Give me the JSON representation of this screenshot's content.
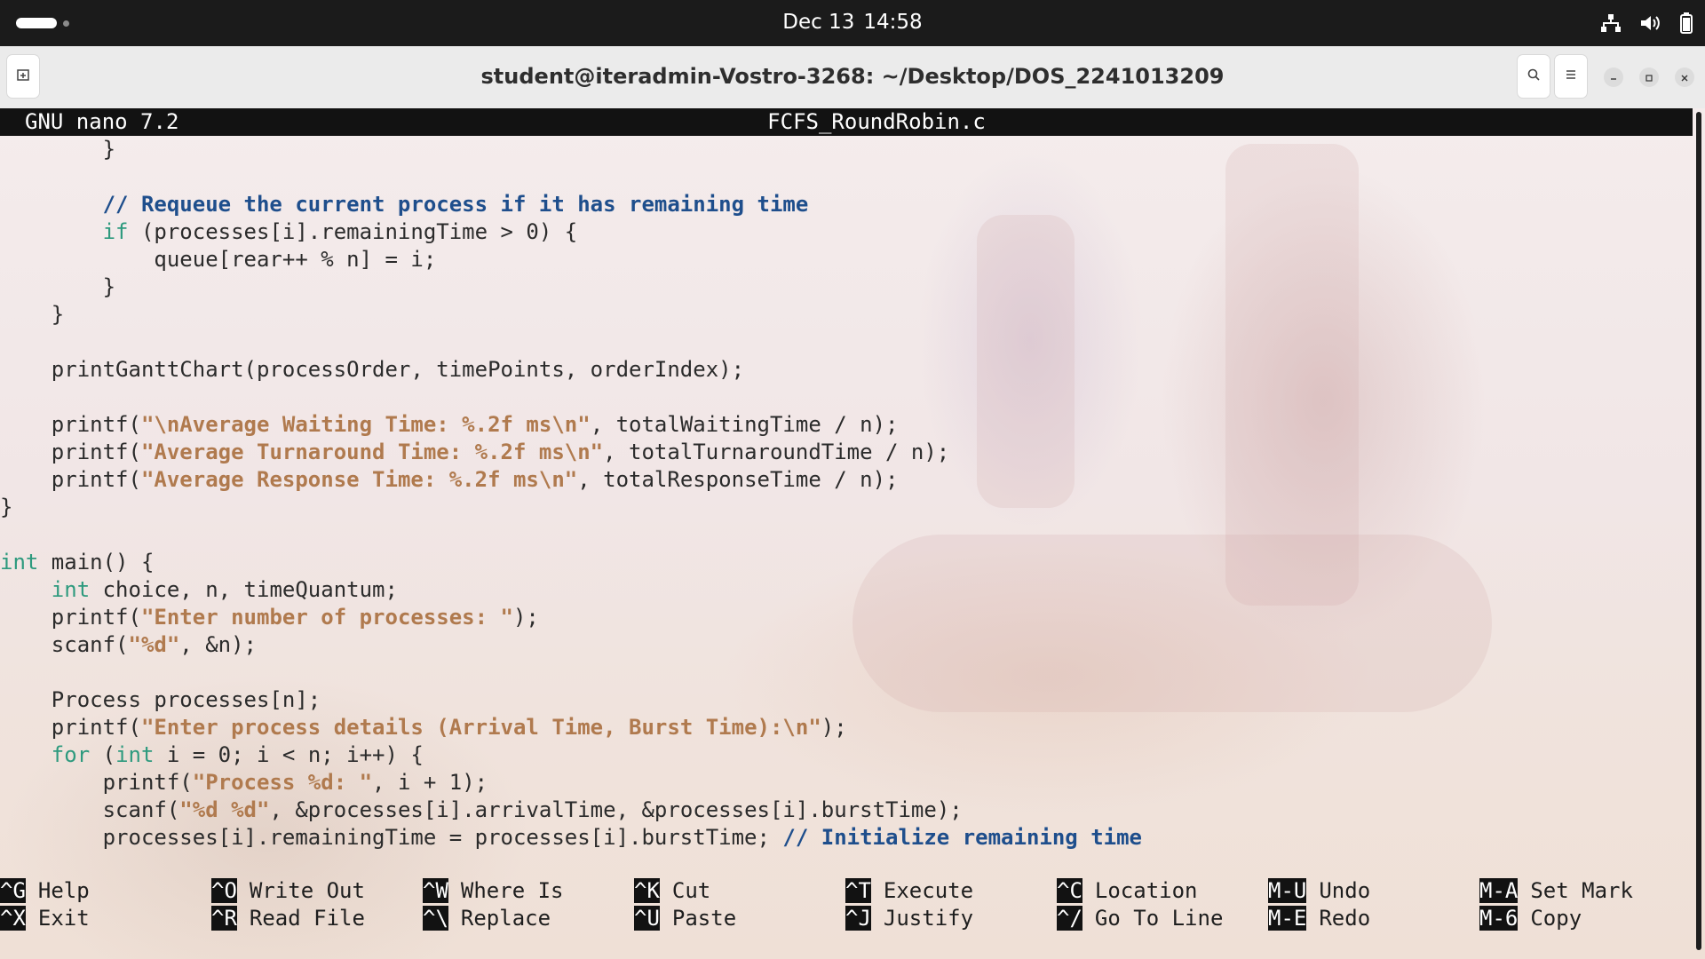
{
  "topbar": {
    "date": "Dec 13",
    "time": "14:58",
    "tray_icons": [
      "network-icon",
      "volume-icon",
      "battery-icon"
    ]
  },
  "window": {
    "title": "student@iteradmin-Vostro-3268: ~/Desktop/DOS_2241013209",
    "buttons": [
      "new-tab-icon",
      "search-icon",
      "menu-icon",
      "minimize-icon",
      "maximize-icon",
      "close-icon"
    ]
  },
  "nano": {
    "version": "GNU nano 7.2",
    "filename": "FCFS_RoundRobin.c"
  },
  "code": {
    "l1_a": "        }",
    "l3_comment": "        // Requeue the current process if it has remaining time",
    "l4_kw": "        if",
    "l4_rest": " (processes[i].remainingTime > 0) {",
    "l5": "            queue[rear++ % n] = i;",
    "l6": "        }",
    "l7": "    }",
    "l9": "    printGanttChart(processOrder, timePoints, orderIndex);",
    "l11_a": "    printf(",
    "l11_s": "\"\\nAverage Waiting Time: %.2f ms\\n\"",
    "l11_b": ", totalWaitingTime / n);",
    "l12_a": "    printf(",
    "l12_s": "\"Average Turnaround Time: %.2f ms\\n\"",
    "l12_b": ", totalTurnaroundTime / n);",
    "l13_a": "    printf(",
    "l13_s": "\"Average Response Time: %.2f ms\\n\"",
    "l13_b": ", totalResponseTime / n);",
    "l14": "}",
    "l16_kw": "int",
    "l16_rest": " main() {",
    "l17_pre": "    ",
    "l17_kw": "int",
    "l17_rest": " choice, n, timeQuantum;",
    "l18_a": "    printf(",
    "l18_s": "\"Enter number of processes: \"",
    "l18_b": ");",
    "l19_a": "    scanf(",
    "l19_s": "\"%d\"",
    "l19_b": ", &n);",
    "l21": "    Process processes[n];",
    "l22_a": "    printf(",
    "l22_s": "\"Enter process details (Arrival Time, Burst Time):\\n\"",
    "l22_b": ");",
    "l23_pre": "    ",
    "l23_kw1": "for",
    "l23_mid": " (",
    "l23_kw2": "int",
    "l23_rest": " i = 0; i < n; i++) {",
    "l24_a": "        printf(",
    "l24_s": "\"Process %d: \"",
    "l24_b": ", i + 1);",
    "l25_a": "        scanf(",
    "l25_s": "\"%d %d\"",
    "l25_b": ", &processes[i].arrivalTime, &processes[i].burstTime);",
    "l26_a": "        processes[i].remainingTime = processes[i].burstTime; ",
    "l26_c": "// Initialize remaining time"
  },
  "shortcuts": [
    {
      "key1": "^G",
      "label1": "Help",
      "key2": "^X",
      "label2": "Exit"
    },
    {
      "key1": "^O",
      "label1": "Write Out",
      "key2": "^R",
      "label2": "Read File"
    },
    {
      "key1": "^W",
      "label1": "Where Is",
      "key2": "^\\",
      "label2": "Replace"
    },
    {
      "key1": "^K",
      "label1": "Cut",
      "key2": "^U",
      "label2": "Paste"
    },
    {
      "key1": "^T",
      "label1": "Execute",
      "key2": "^J",
      "label2": "Justify"
    },
    {
      "key1": "^C",
      "label1": "Location",
      "key2": "^/",
      "label2": "Go To Line"
    },
    {
      "key1": "M-U",
      "label1": "Undo",
      "key2": "M-E",
      "label2": "Redo"
    },
    {
      "key1": "M-A",
      "label1": "Set Mark",
      "key2": "M-6",
      "label2": "Copy"
    }
  ]
}
